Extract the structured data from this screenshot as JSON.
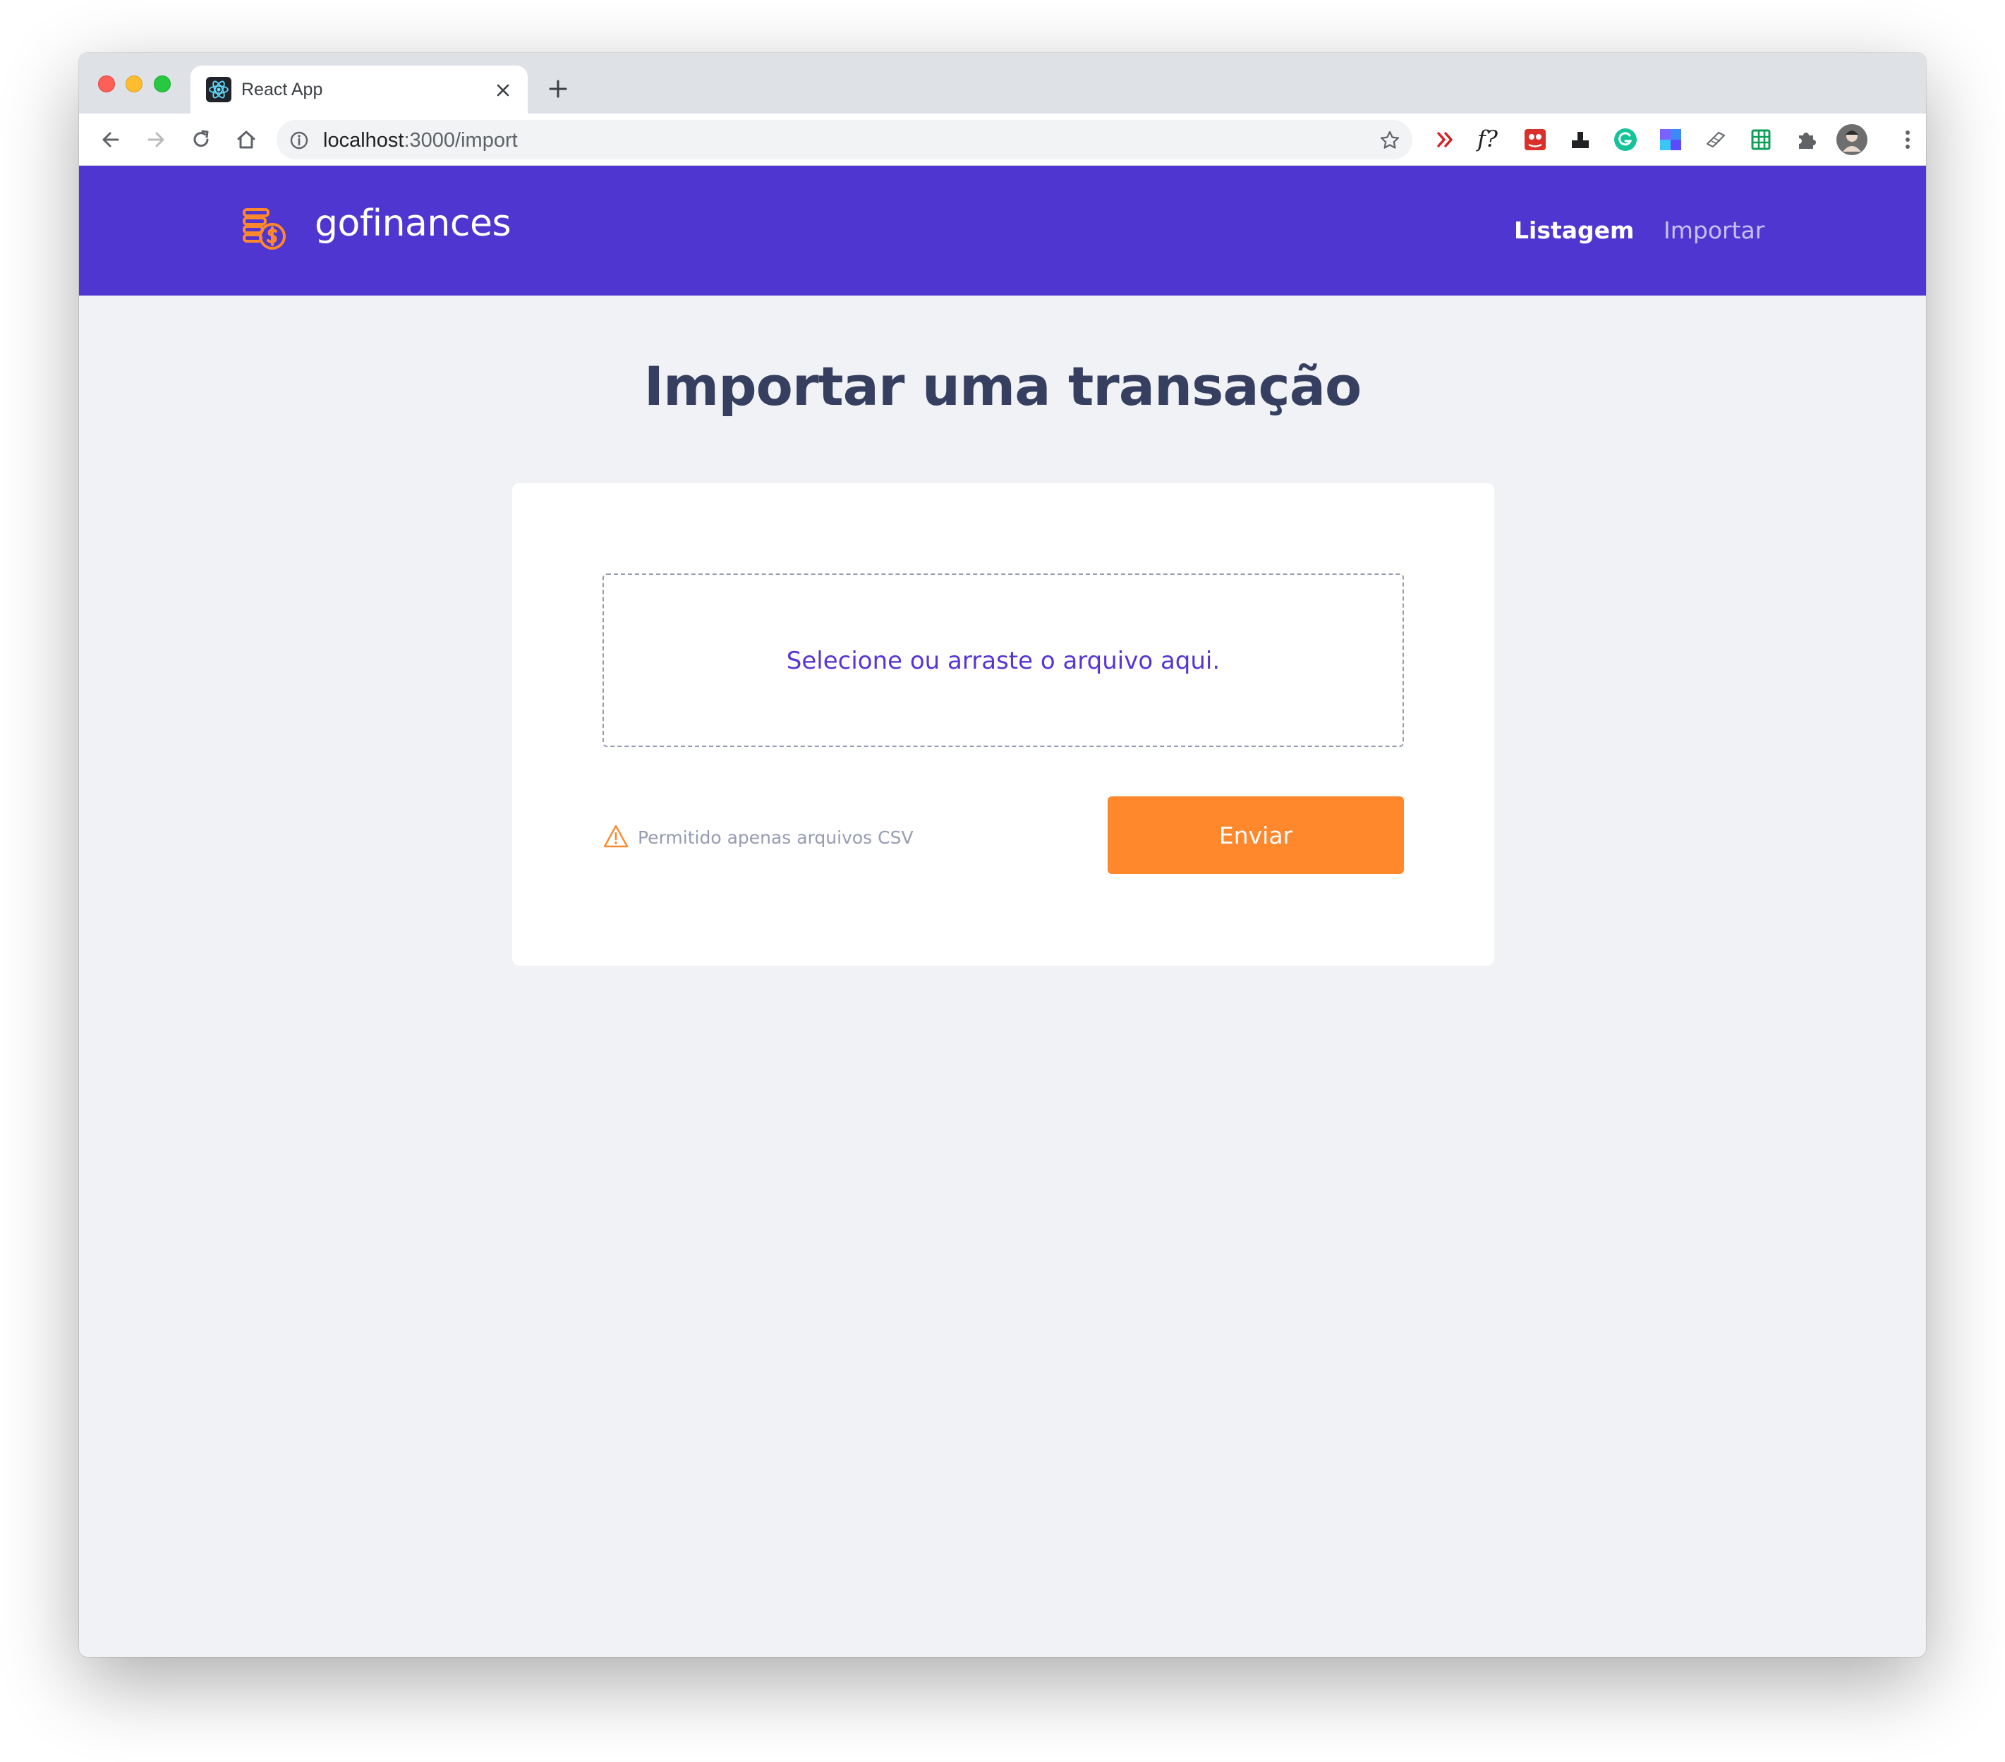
{
  "browser": {
    "tab_title": "React App",
    "url_host": "localhost",
    "url_path": ":3000/import",
    "extensions": [
      "double-chevron-ext-icon",
      "formula-ext-icon",
      "red-ext-icon",
      "black-ext-icon",
      "grammarly-icon",
      "blocks-ext-icon",
      "note-ext-icon",
      "sheets-icon",
      "puzzle-icon",
      "profile-avatar",
      "kebab-menu-icon"
    ],
    "formula_ext_label": "f?"
  },
  "app": {
    "brand": "gofinances",
    "nav": {
      "listagem": "Listagem",
      "importar": "Importar"
    },
    "colors": {
      "primary": "#5036d0",
      "accent": "#ff872c",
      "title": "#363f5f",
      "muted": "#969cb3",
      "background": "#f0f2f5"
    }
  },
  "import": {
    "title": "Importar uma transação",
    "dropzone_text": "Selecione ou arraste o arquivo aqui.",
    "csv_note": "Permitido apenas arquivos CSV",
    "submit_label": "Enviar"
  }
}
